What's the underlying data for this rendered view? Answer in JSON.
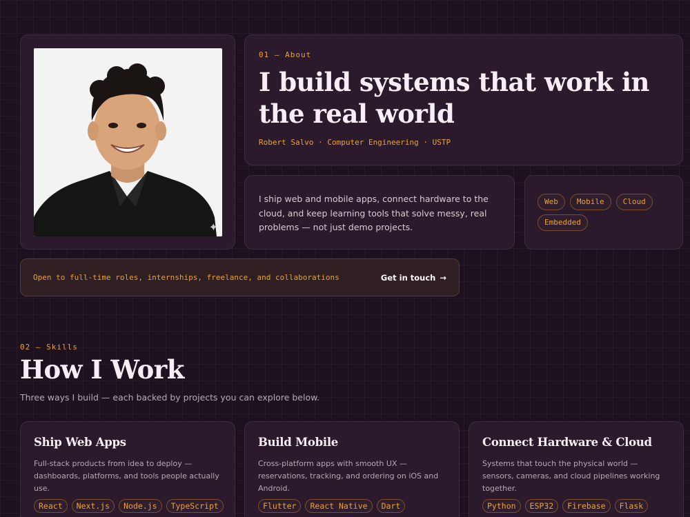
{
  "about": {
    "eyebrow": "01 — About",
    "title": "I build systems that work in the real world",
    "meta": "Robert Salvo · Computer Engineering · USTP",
    "bio": "I ship web and mobile apps, connect hardware to the cloud, and keep learning tools that solve messy, real problems — not just demo projects.",
    "tags": [
      "Web",
      "Mobile",
      "Cloud",
      "Embedded"
    ],
    "photo_icon": "sparkle-icon"
  },
  "cta": {
    "text": "Open to full-time roles, internships, freelance, and collaborations",
    "button_label": "Get in touch",
    "button_icon": "→"
  },
  "skills": {
    "eyebrow": "02 — Skills",
    "title": "How I Work",
    "subtitle": "Three ways I build — each backed by projects you can explore below.",
    "cards": [
      {
        "title": "Ship Web Apps",
        "desc": "Full-stack products from idea to deploy — dashboards, platforms, and tools people actually use.",
        "tags": [
          "React",
          "Next.js",
          "Node.js",
          "TypeScript"
        ]
      },
      {
        "title": "Build Mobile",
        "desc": "Cross-platform apps with smooth UX — reservations, tracking, and ordering on iOS and Android.",
        "tags": [
          "Flutter",
          "React Native",
          "Dart"
        ]
      },
      {
        "title": "Connect Hardware & Cloud",
        "desc": "Systems that touch the physical world — sensors, cameras, and cloud pipelines working together.",
        "tags": [
          "Python",
          "ESP32",
          "Firebase",
          "Flask"
        ]
      }
    ]
  },
  "colors": {
    "background": "#1e111f",
    "card": "#2a1a2c",
    "accent": "#e8a33c"
  }
}
